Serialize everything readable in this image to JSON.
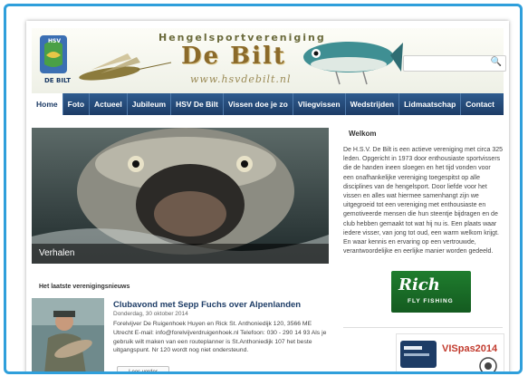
{
  "header": {
    "club_prefix": "Hengelsportvereniging",
    "club_name": "De Bilt",
    "website": "www.hsvdebilt.nl",
    "logo_text": "DE BILT",
    "logo_top": "HSV"
  },
  "search": {
    "placeholder": ""
  },
  "nav": {
    "items": [
      "Home",
      "Foto",
      "Actueel",
      "Jubileum",
      "HSV De Bilt",
      "Vissen doe je zo",
      "Vliegvissen",
      "Wedstrijden",
      "Lidmaatschap",
      "Contact"
    ]
  },
  "hero": {
    "label": "Verhalen"
  },
  "welcome": {
    "title": "Welkom",
    "text": "De H.S.V. De Bilt is een actieve vereniging met circa 325 leden. Opgericht in 1973 door enthousiaste sportvissers die de handen ineen sloegen en het tijd vonden voor een onafhankelijke vereniging toegespitst op alle disciplines van de hengelsport. Door liefde voor het vissen en alles wat hiermee samenhangt zijn we uitgegroeid tot een vereniging met enthousiaste en gemotiveerde mensen die hun steentje bijdragen en de club hebben gemaakt tot wat hij nu is. Een plaats waar iedere visser, van jong tot oud, een warm welkom krijgt. En waar kennis en ervaring op een vertrouwde, verantwoordelijke en eerlijke manier worden gedeeld."
  },
  "news": {
    "heading": "Het laatste verenigingsnieuws",
    "title": "Clubavond met Sepp Fuchs over Alpenlanden",
    "date": "Donderdag, 30 oktober 2014",
    "body": "Forelvijver De Ruigenhoek Huyen en Rick St. Anthoniedijk 120, 3566 ME Utrecht E-mail: info@forelvijverdruigenhoek.nl Telefoon: 030 - 290 14 93 Als je gebruik wilt maken van een routeplanner is St.Anthoniedijk 107 het beste uitgangspunt. Nr 120 wordt nog niet ondersteund.",
    "read_more": "Lees verder"
  },
  "sponsor": {
    "name": "Rich",
    "tagline": "FLY FISHING"
  },
  "vispas": {
    "label": "VISpas2014"
  },
  "colors": {
    "frame": "#2f9fdb",
    "nav": "#1d3c66",
    "title": "#8b6a2a"
  }
}
